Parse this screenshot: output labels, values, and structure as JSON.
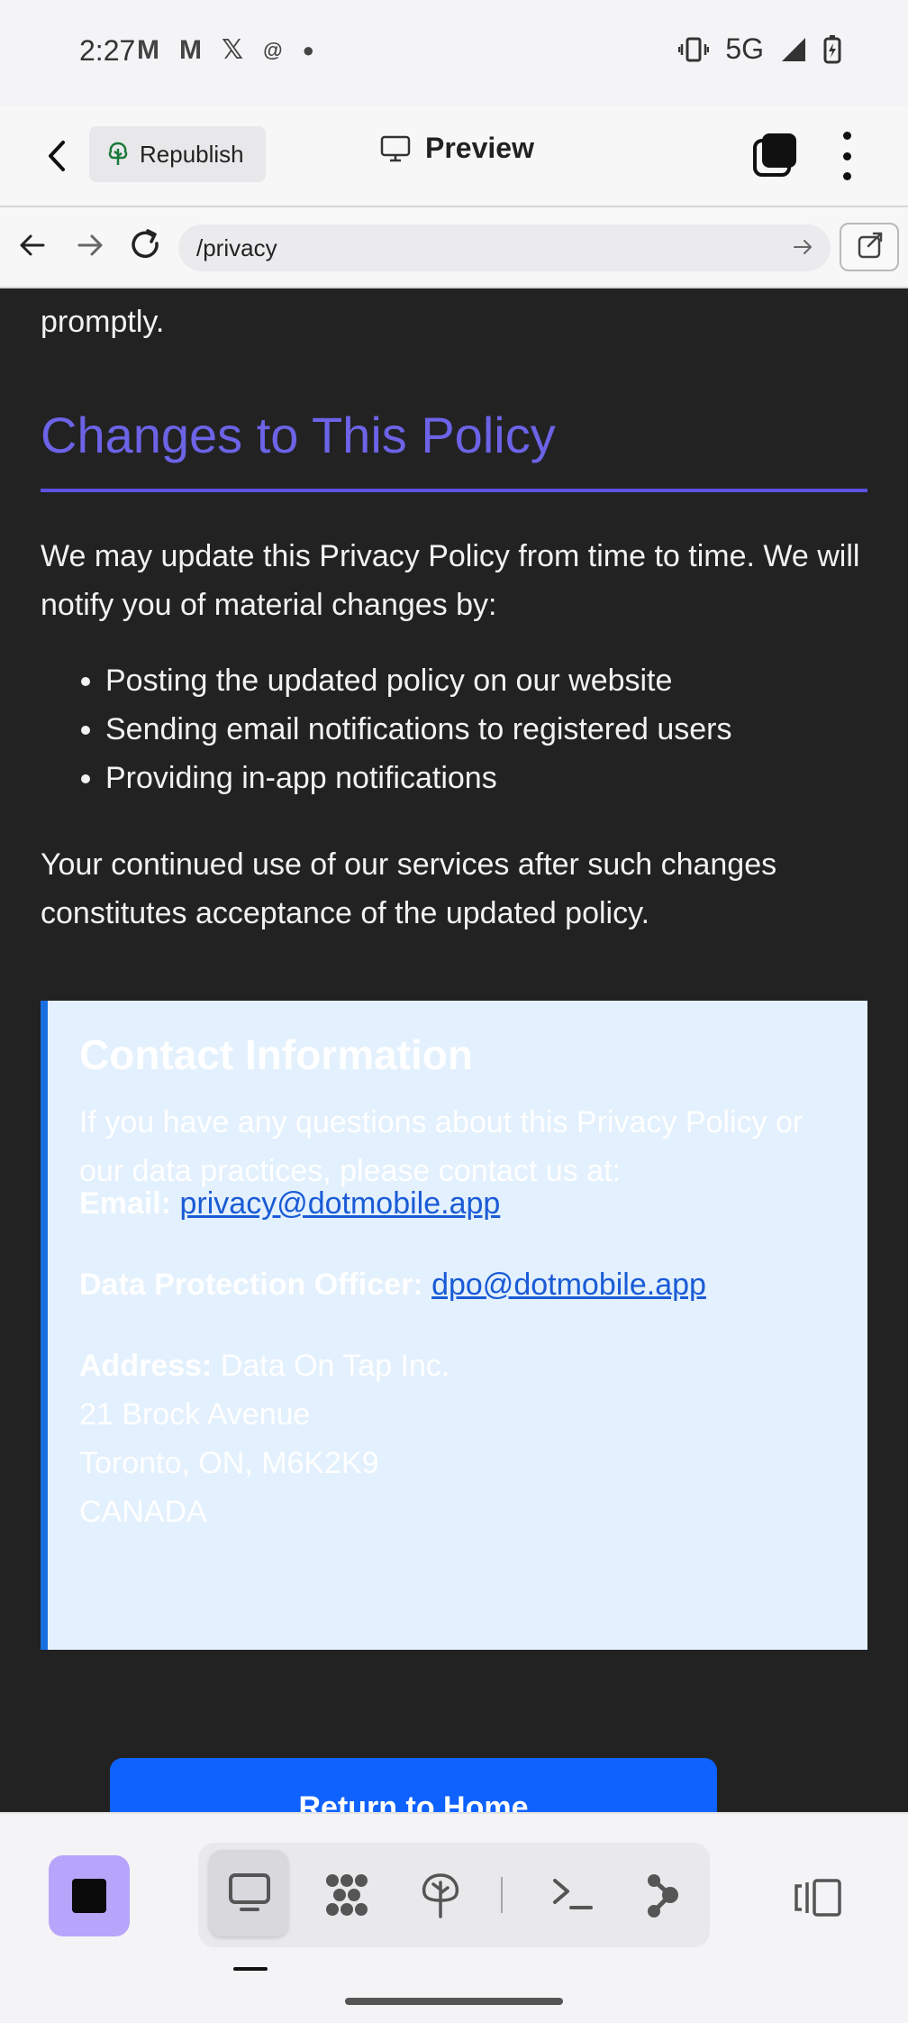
{
  "status_bar": {
    "time": "2:27",
    "network": "5G",
    "left_icons": [
      "gmail-icon",
      "gmail-icon",
      "x-icon",
      "threads-icon",
      "dot-icon"
    ],
    "right_icons": [
      "vibrate-icon",
      "signal-icon",
      "battery-charging-icon"
    ]
  },
  "app_header": {
    "republish_label": "Republish",
    "title": "Preview"
  },
  "url_bar": {
    "url": "/privacy"
  },
  "page": {
    "previous_text": "promptly.",
    "section_heading": "Changes to This Policy",
    "intro_paragraph": "We may update this Privacy Policy from time to time. We will notify you of material changes by:",
    "bullets": [
      "Posting the updated policy on our website",
      "Sending email notifications to registered users",
      "Providing in-app notifications"
    ],
    "closing_paragraph": "Your continued use of our services after such changes constitutes acceptance of the updated policy.",
    "contact": {
      "title": "Contact Information",
      "intro": "If you have any questions about this Privacy Policy or our data practices, please contact us at:",
      "email_label": "Email:",
      "email": "privacy@dotmobile.app",
      "dpo_label": "Data Protection Officer:",
      "dpo_email": "dpo@dotmobile.app",
      "address_label": "Address:",
      "address_lines": [
        "Data On Tap Inc.",
        "21 Brock Avenue",
        "Toronto, ON, M6K2K9",
        "CANADA"
      ]
    },
    "return_button_label": "Return to Home"
  },
  "colors": {
    "page_background": "#222223",
    "heading": "#6c63e6",
    "contact_box": "#e3f0fd",
    "contact_accent": "#1a6fe0",
    "link": "#1a5bd6",
    "button": "#0f62fe",
    "stop_button": "#b7a5fb"
  },
  "bottom_toolbar": {
    "tools": [
      "preview-icon",
      "nodes-icon",
      "deploy-icon",
      "terminal-icon",
      "graph-icon"
    ],
    "active_tool": "preview-icon"
  }
}
